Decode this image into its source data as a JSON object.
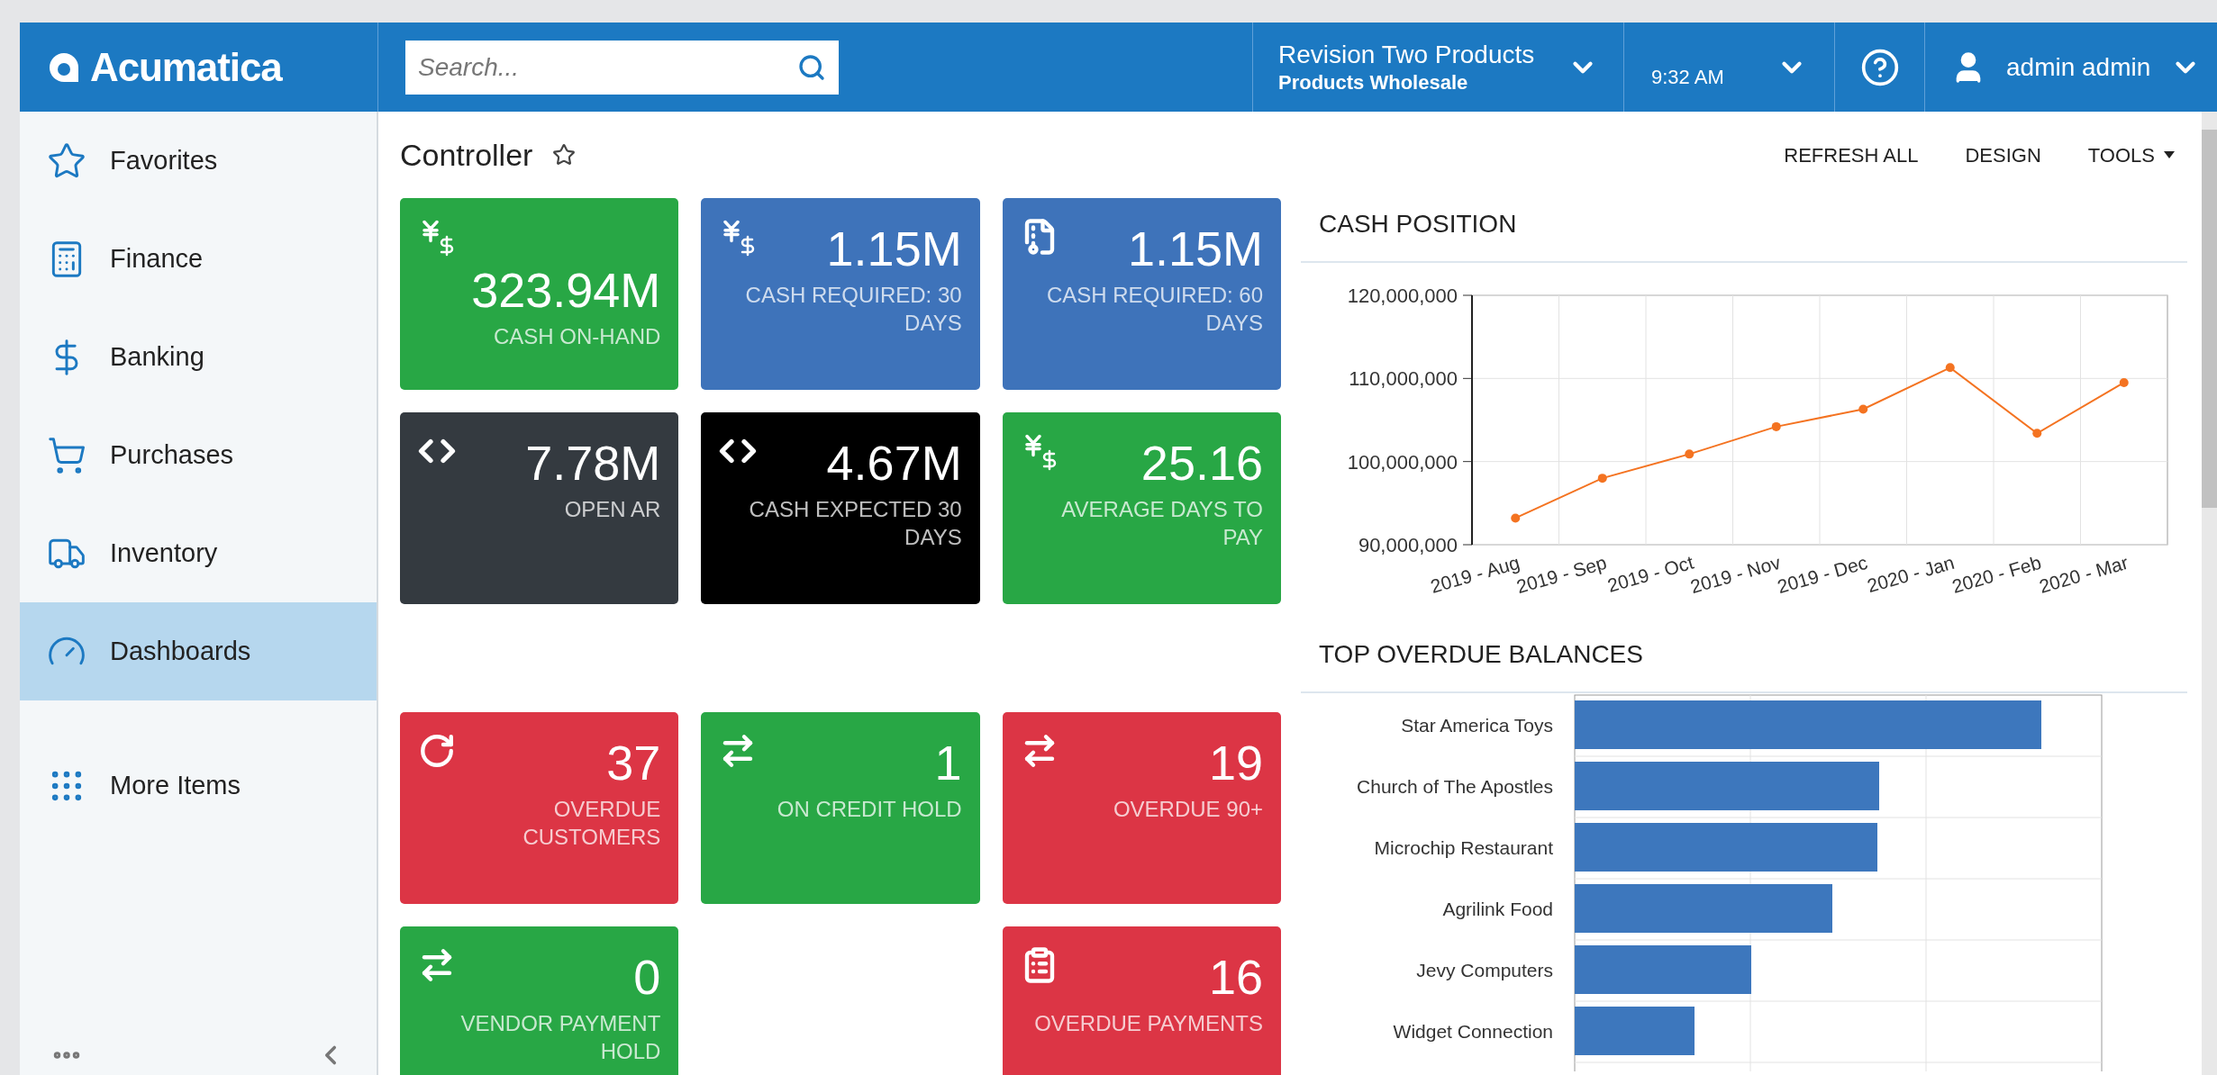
{
  "brand": "Acumatica",
  "search": {
    "placeholder": "Search..."
  },
  "company": {
    "name": "Revision Two Products",
    "branch": "Products Wholesale"
  },
  "time": "9:32 AM",
  "user": "admin admin",
  "sidebar": {
    "items": [
      {
        "label": "Favorites",
        "selected": false
      },
      {
        "label": "Finance",
        "selected": false
      },
      {
        "label": "Banking",
        "selected": false
      },
      {
        "label": "Purchases",
        "selected": false
      },
      {
        "label": "Inventory",
        "selected": false
      },
      {
        "label": "Dashboards",
        "selected": true
      },
      {
        "label": "More Items",
        "selected": false
      }
    ]
  },
  "page": {
    "title": "Controller",
    "actions": [
      "REFRESH ALL",
      "DESIGN",
      "TOOLS"
    ]
  },
  "tiles_top": [
    {
      "value": "323.94M",
      "label": "CASH ON-HAND",
      "color": "#28a745"
    },
    {
      "value": "1.15M",
      "label": "CASH REQUIRED: 30 DAYS",
      "color": "#3e73ba"
    },
    {
      "value": "1.15M",
      "label": "CASH REQUIRED: 60 DAYS",
      "color": "#3e73ba"
    },
    {
      "value": "7.78M",
      "label": "OPEN AR",
      "color": "#343a40"
    },
    {
      "value": "4.67M",
      "label": "CASH EXPECTED 30 DAYS",
      "color": "#000000"
    },
    {
      "value": "25.16",
      "label": "AVERAGE DAYS TO PAY",
      "color": "#28a745"
    }
  ],
  "tiles_bottom": [
    {
      "value": "37",
      "label": "OVERDUE CUSTOMERS",
      "color": "#dc3545"
    },
    {
      "value": "1",
      "label": "ON CREDIT HOLD",
      "color": "#28a745"
    },
    {
      "value": "19",
      "label": "OVERDUE 90+",
      "color": "#dc3545"
    },
    {
      "value": "0",
      "label": "VENDOR PAYMENT HOLD",
      "color": "#28a745"
    },
    {
      "value": "16",
      "label": "OVERDUE PAYMENTS",
      "color": "#dc3545"
    }
  ],
  "cash_position": {
    "title": "CASH POSITION",
    "chart_data": {
      "type": "line",
      "categories": [
        "2019 - Aug",
        "2019 - Sep",
        "2019 - Oct",
        "2019 - Nov",
        "2019 - Dec",
        "2020 - Jan",
        "2020 - Feb",
        "2020 - Mar"
      ],
      "series": [
        {
          "color": "#f47321",
          "marker": true,
          "values": [
            93200000,
            98000000,
            100900000,
            104200000,
            106300000,
            111300000,
            103400000,
            109500000
          ]
        }
      ],
      "ylim": [
        90000000,
        120000000
      ],
      "yticks": [
        {
          "value": 90000000,
          "label": "90,000,000"
        },
        {
          "value": 100000000,
          "label": "100,000,000"
        },
        {
          "value": 110000000,
          "label": "110,000,000"
        },
        {
          "value": 120000000,
          "label": "120,000,000"
        }
      ]
    }
  },
  "top_overdue": {
    "title": "TOP OVERDUE BALANCES",
    "customers": [
      "Star America Toys",
      "Church of The Apostles",
      "Microchip Restaurant",
      "Agrilink Food",
      "Jevy Computers",
      "Widget Connection"
    ]
  }
}
